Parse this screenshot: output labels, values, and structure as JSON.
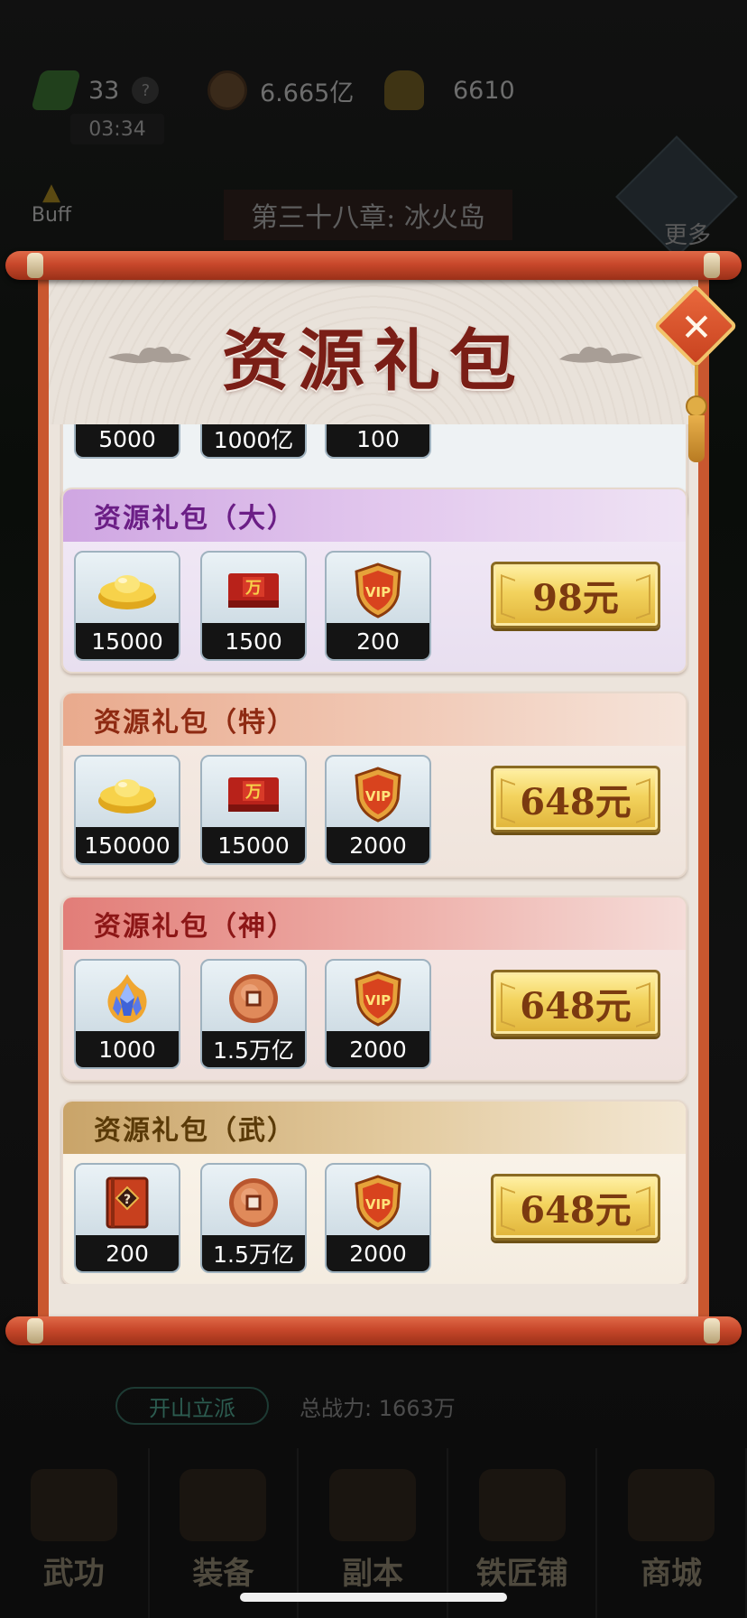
{
  "background": {
    "resources": {
      "stamina": "33",
      "coins": "6.665亿",
      "ingots": "6610"
    },
    "timer": "03:34",
    "buff_label": "Buff",
    "chapter_title": "第三十八章: 冰火岛",
    "more_label": "更多",
    "sect_button": "开山立派",
    "total_power": "总战力: 1663万",
    "nav": [
      "武功",
      "装备",
      "副本",
      "铁匠铺",
      "商城"
    ]
  },
  "dialog": {
    "title": "资源礼包",
    "close_icon": "close-x-icon"
  },
  "packs": [
    {
      "name": "",
      "items": [
        {
          "icon": "ingot-icon",
          "count": "5000"
        },
        {
          "icon": "copper-coin-icon",
          "count": "1000亿"
        },
        {
          "icon": "vip-badge-icon",
          "count": "100"
        }
      ],
      "price": ""
    },
    {
      "name": "资源礼包（大）",
      "items": [
        {
          "icon": "gold-ingot-icon",
          "count": "15000"
        },
        {
          "icon": "red-token-box-icon",
          "count": "1500"
        },
        {
          "icon": "vip-badge-icon",
          "count": "200"
        }
      ],
      "price": "98元"
    },
    {
      "name": "资源礼包（特）",
      "items": [
        {
          "icon": "gold-ingot-icon",
          "count": "150000"
        },
        {
          "icon": "red-token-box-icon",
          "count": "15000"
        },
        {
          "icon": "vip-badge-icon",
          "count": "2000"
        }
      ],
      "price": "648元"
    },
    {
      "name": "资源礼包（神）",
      "items": [
        {
          "icon": "crystal-flame-icon",
          "count": "1000"
        },
        {
          "icon": "copper-coin-icon",
          "count": "1.5万亿"
        },
        {
          "icon": "vip-badge-icon",
          "count": "2000"
        }
      ],
      "price": "648元"
    },
    {
      "name": "资源礼包（武）",
      "items": [
        {
          "icon": "mystery-book-icon",
          "count": "200"
        },
        {
          "icon": "copper-coin-icon",
          "count": "1.5万亿"
        },
        {
          "icon": "vip-badge-icon",
          "count": "2000"
        }
      ],
      "price": "648元"
    }
  ],
  "glyphs": {
    "token_char": "万",
    "vip": "VIP",
    "mystery": "?",
    "close": "✕"
  }
}
